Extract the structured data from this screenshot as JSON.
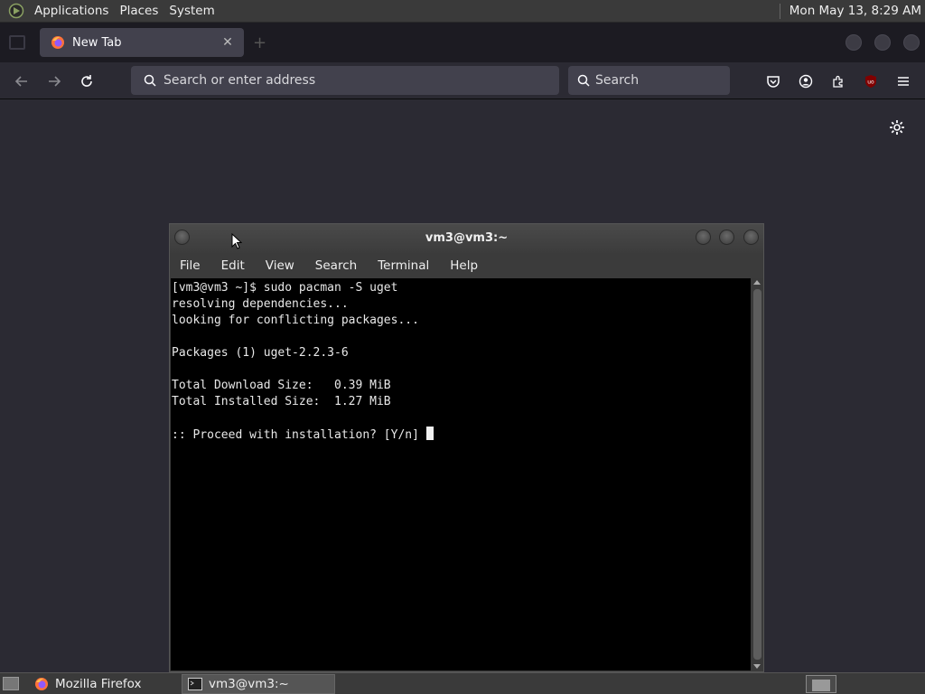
{
  "top_panel": {
    "menus": [
      "Applications",
      "Places",
      "System"
    ],
    "clock": "Mon May 13,  8:29 AM"
  },
  "browser": {
    "tab": {
      "title": "New Tab",
      "close_glyph": "✕"
    },
    "urlbar": {
      "placeholder": "Search or enter address"
    },
    "searchbar": {
      "placeholder": "Search"
    },
    "icons": [
      "back-icon",
      "forward-icon",
      "reload-icon",
      "search-icon",
      "pocket-icon",
      "account-icon",
      "extensions-icon",
      "ublock-icon",
      "menu-icon",
      "settings-gear-icon"
    ],
    "ublock_badge": "uo"
  },
  "terminal": {
    "title": "vm3@vm3:~",
    "menu": [
      "File",
      "Edit",
      "View",
      "Search",
      "Terminal",
      "Help"
    ],
    "lines": [
      "[vm3@vm3 ~]$ sudo pacman -S uget",
      "resolving dependencies...",
      "looking for conflicting packages...",
      "",
      "Packages (1) uget-2.2.3-6",
      "",
      "Total Download Size:   0.39 MiB",
      "Total Installed Size:  1.27 MiB",
      "",
      ":: Proceed with installation? [Y/n] "
    ]
  },
  "taskbar": {
    "tasks": [
      {
        "label": "Mozilla Firefox",
        "active": false,
        "icon": "firefox-icon"
      },
      {
        "label": "vm3@vm3:~",
        "active": true,
        "icon": "terminal-icon"
      }
    ]
  },
  "colors": {
    "panel": "#3a3a3a",
    "browser_bg": "#2b2a33",
    "terminal_bg": "#000000",
    "ublock_red": "#800000"
  }
}
